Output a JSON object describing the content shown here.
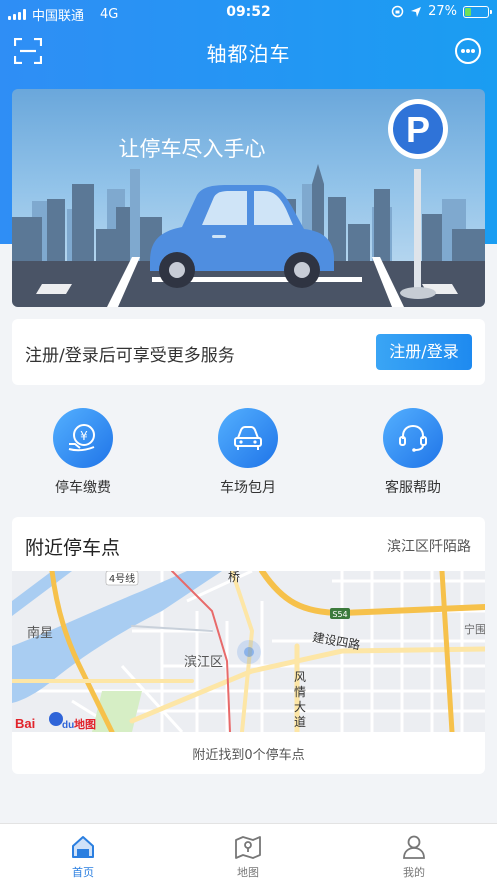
{
  "status_bar": {
    "carrier": "中国联通",
    "network": "4G",
    "time": "09:52",
    "battery": "27%",
    "battery_level": 0.27
  },
  "header": {
    "title": "轴都泊车",
    "scan_icon": "scan-icon",
    "chat_icon": "chat-bubble-icon"
  },
  "banner": {
    "slogan": "让停车尽入手心",
    "sign_letter": "P"
  },
  "login_card": {
    "tip": "注册/登录后可享受更多服务",
    "button": "注册/登录"
  },
  "actions": [
    {
      "label": "停车缴费",
      "icon": "yen-pay-icon"
    },
    {
      "label": "车场包月",
      "icon": "car-icon"
    },
    {
      "label": "客服帮助",
      "icon": "headset-icon"
    }
  ],
  "nearby": {
    "title": "附近停车点",
    "location": "滨江区阡陌路",
    "found_text": "附近找到0个停车点",
    "map": {
      "labels": {
        "line4": "4号线",
        "nanxing": "南星",
        "binjiang": "滨江区",
        "jianshe": "建设四路",
        "fengqing": "风情大道",
        "road_s54": "S54",
        "ning": "宁围",
        "qiao": "桥",
        "logo_bai": "Bai",
        "logo_du": "du",
        "logo_map": "地图"
      }
    }
  },
  "tabbar": [
    {
      "label": "首页",
      "icon": "home-icon",
      "active": true
    },
    {
      "label": "地图",
      "icon": "map-icon",
      "active": false
    },
    {
      "label": "我的",
      "icon": "user-icon",
      "active": false
    }
  ],
  "colors": {
    "primary": "#2f8ef5",
    "active_tab": "#2b7fe0",
    "battery_fill": "#6fe05a"
  }
}
